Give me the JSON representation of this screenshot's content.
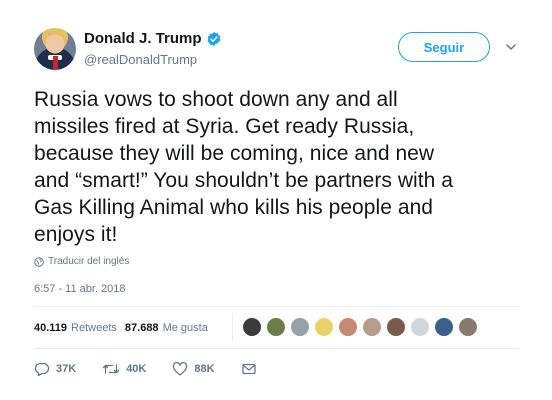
{
  "author": {
    "display_name": "Donald J. Trump",
    "handle": "@realDonaldTrump",
    "verified_color": "#1da1f2"
  },
  "follow_label": "Seguir",
  "tweet_lines": [
    "Russia vows to shoot down any and all",
    "missiles fired at Syria. Get ready Russia,",
    "because they will be coming, nice and new",
    "and “smart!” You shouldn’t be partners with a",
    "Gas Killing Animal who kills his people and",
    "enjoys it!"
  ],
  "translate_label": "Traducir del inglés",
  "timestamp": "6:57 - 11 abr. 2018",
  "stats": {
    "retweets_count": "40.119",
    "retweets_label": "Retweets",
    "likes_count": "87.688",
    "likes_label": "Me gusta"
  },
  "liker_avatar_colors": [
    "#3b3b3b",
    "#6a7d4a",
    "#9aa0a8",
    "#e8d36a",
    "#c58a73",
    "#b89c8a",
    "#7a5a4c",
    "#d0d6de",
    "#3e5f8a",
    "#8b7a6b"
  ],
  "actions": {
    "reply_count": "37K",
    "retweet_count": "40K",
    "like_count": "88K"
  },
  "icons": {
    "verified": "verified-badge-icon",
    "caret": "chevron-down-icon",
    "globe": "globe-icon",
    "reply": "reply-icon",
    "retweet": "retweet-icon",
    "like": "heart-icon",
    "dm": "envelope-icon"
  }
}
